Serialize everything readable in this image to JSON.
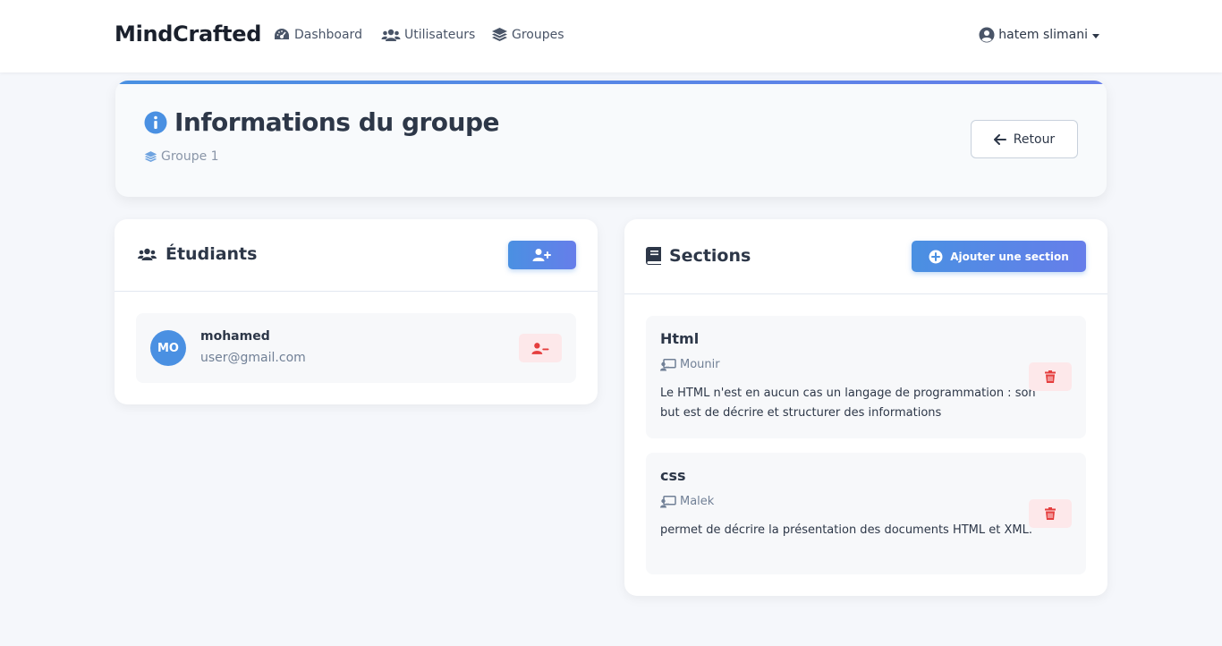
{
  "navbar": {
    "brand": "MindCrafted",
    "links": [
      {
        "label": "Dashboard",
        "icon": "dashboard-gauge-icon"
      },
      {
        "label": "Utilisateurs",
        "icon": "users-icon"
      },
      {
        "label": "Groupes",
        "icon": "layers-icon"
      }
    ],
    "user_name": "hatem slimani"
  },
  "header": {
    "title": "Informations du groupe",
    "group_name": "Groupe 1",
    "back_label": "Retour"
  },
  "students": {
    "title": "Étudiants",
    "items": [
      {
        "initials": "MO",
        "name": "mohamed",
        "email": "user@gmail.com"
      }
    ]
  },
  "sections": {
    "title": "Sections",
    "add_label": "Ajouter une section",
    "items": [
      {
        "title": "Html",
        "teacher": "Mounir",
        "description": "Le HTML n'est en aucun cas un langage de programmation : son but est de décrire et structurer des informations"
      },
      {
        "title": "css",
        "teacher": "Malek",
        "description": "permet de décrire la présentation des documents HTML et XML."
      }
    ]
  },
  "colors": {
    "accent": "#4a90e2",
    "accent_end": "#667eea",
    "danger": "#e53e3e",
    "danger_bg": "#fde8ea",
    "text": "#2d3748",
    "muted": "#718096"
  }
}
